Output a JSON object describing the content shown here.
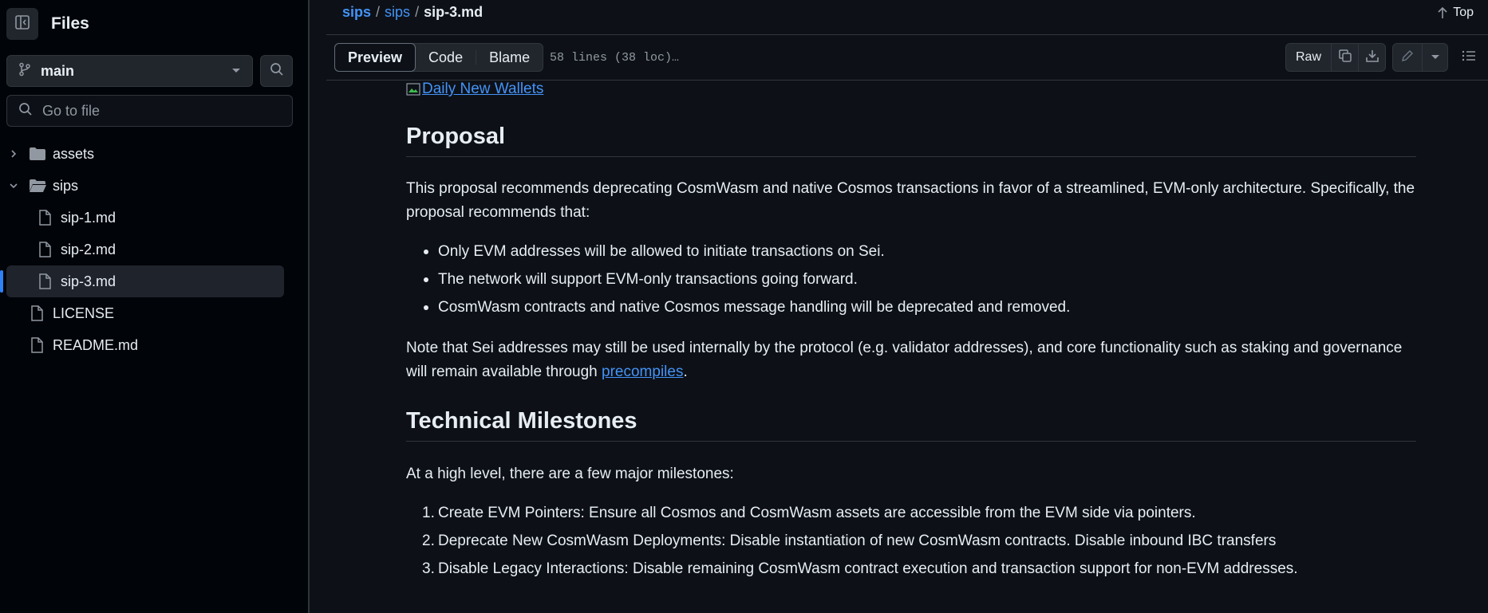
{
  "sidebar": {
    "title": "Files",
    "branch": "main",
    "search_placeholder": "Go to file",
    "tree": [
      {
        "label": "assets",
        "type": "folder",
        "expanded": false
      },
      {
        "label": "sips",
        "type": "folder",
        "expanded": true
      },
      {
        "label": "sip-1.md",
        "type": "file"
      },
      {
        "label": "sip-2.md",
        "type": "file"
      },
      {
        "label": "sip-3.md",
        "type": "file",
        "active": true
      },
      {
        "label": "LICENSE",
        "type": "file"
      },
      {
        "label": "README.md",
        "type": "file"
      }
    ]
  },
  "header": {
    "breadcrumb": [
      "sips",
      "sips",
      "sip-3.md"
    ],
    "separator": "/",
    "top_label": "Top"
  },
  "toolbar": {
    "tabs": [
      "Preview",
      "Code",
      "Blame"
    ],
    "active_tab": "Preview",
    "lines_info": "58 lines (38 loc)…",
    "raw_label": "Raw"
  },
  "content": {
    "image_link": "Daily New Wallets",
    "h_proposal": "Proposal",
    "p1": "This proposal recommends deprecating CosmWasm and native Cosmos transactions in favor of a streamlined, EVM-only architecture. Specifically, the proposal recommends that:",
    "bullets": [
      "Only EVM addresses will be allowed to initiate transactions on Sei.",
      "The network will support EVM-only transactions going forward.",
      "CosmWasm contracts and native Cosmos message handling will be deprecated and removed."
    ],
    "p2_before": "Note that Sei addresses may still be used internally by the protocol (e.g. validator addresses), and core functionality such as staking and governance will remain available through ",
    "p2_link": "precompiles",
    "p2_after": ".",
    "h_milestones": "Technical Milestones",
    "p3": "At a high level, there are a few major milestones:",
    "milestones": [
      "Create EVM Pointers: Ensure all Cosmos and CosmWasm assets are accessible from the EVM side via pointers.",
      "Deprecate New CosmWasm Deployments: Disable instantiation of new CosmWasm contracts. Disable inbound IBC transfers",
      "Disable Legacy Interactions: Disable remaining CosmWasm contract execution and transaction support for non-EVM addresses."
    ],
    "milestone_numbers": [
      "1.",
      "2.",
      "3."
    ]
  },
  "colors": {
    "background": "#0d1117",
    "sidebar_bg": "#010409",
    "link": "#4493f8",
    "border": "#30363d",
    "text": "#e6edf3",
    "muted": "#9198a1",
    "active_marker": "#2f81f7"
  },
  "icons": [
    "sidebar-toggle-icon",
    "git-branch-icon",
    "caret-down-icon",
    "search-icon",
    "chevron-right-icon",
    "chevron-down-icon",
    "folder-icon",
    "file-icon",
    "arrow-up-icon",
    "copy-icon",
    "download-icon",
    "pencil-icon",
    "list-icon",
    "broken-image-icon"
  ]
}
